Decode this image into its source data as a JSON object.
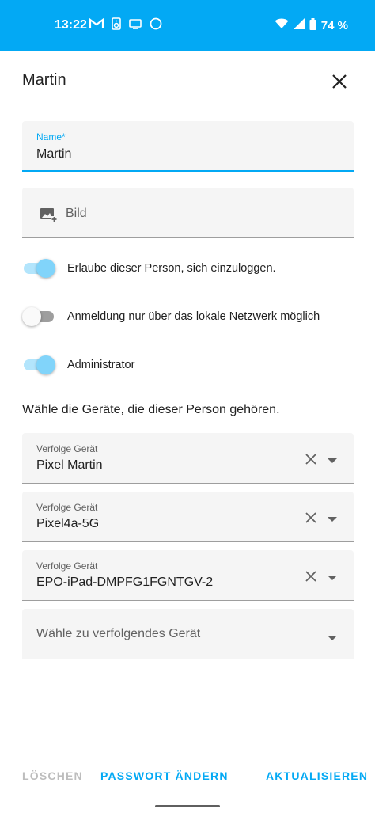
{
  "status_bar": {
    "time": "13:22",
    "battery": "74 %",
    "icons_left": [
      "gmail-icon",
      "speaker-icon",
      "cast-icon",
      "circle-icon"
    ],
    "icons_right": [
      "wifi-icon",
      "signal-icon",
      "battery-icon"
    ],
    "color": "#03a9f4"
  },
  "dialog": {
    "title": "Martin",
    "close_icon": "close-icon"
  },
  "name_field": {
    "label": "Name*",
    "value": "Martin"
  },
  "image_field": {
    "label": "Bild",
    "icon": "add-photo-icon"
  },
  "toggles": [
    {
      "label": "Erlaube dieser Person, sich einzuloggen.",
      "state": "on"
    },
    {
      "label": "Anmeldung nur über das lokale Netzwerk möglich",
      "state": "off"
    },
    {
      "label": "Administrator",
      "state": "on"
    }
  ],
  "devices_heading": "Wähle die Geräte, die dieser Person gehören.",
  "device_fields": [
    {
      "label": "Verfolge Gerät",
      "value": "Pixel Martin"
    },
    {
      "label": "Verfolge Gerät",
      "value": "Pixel4a-5G"
    },
    {
      "label": "Verfolge Gerät",
      "value": "EPO-iPad-DMPFG1FGNTGV-2"
    }
  ],
  "new_device_placeholder": "Wähle zu verfolgendes Gerät",
  "actions": {
    "delete": "LÖSCHEN",
    "change_password": "PASSWORT ÄNDERN",
    "update": "AKTUALISIEREN"
  },
  "accent_color": "#03a9f4"
}
